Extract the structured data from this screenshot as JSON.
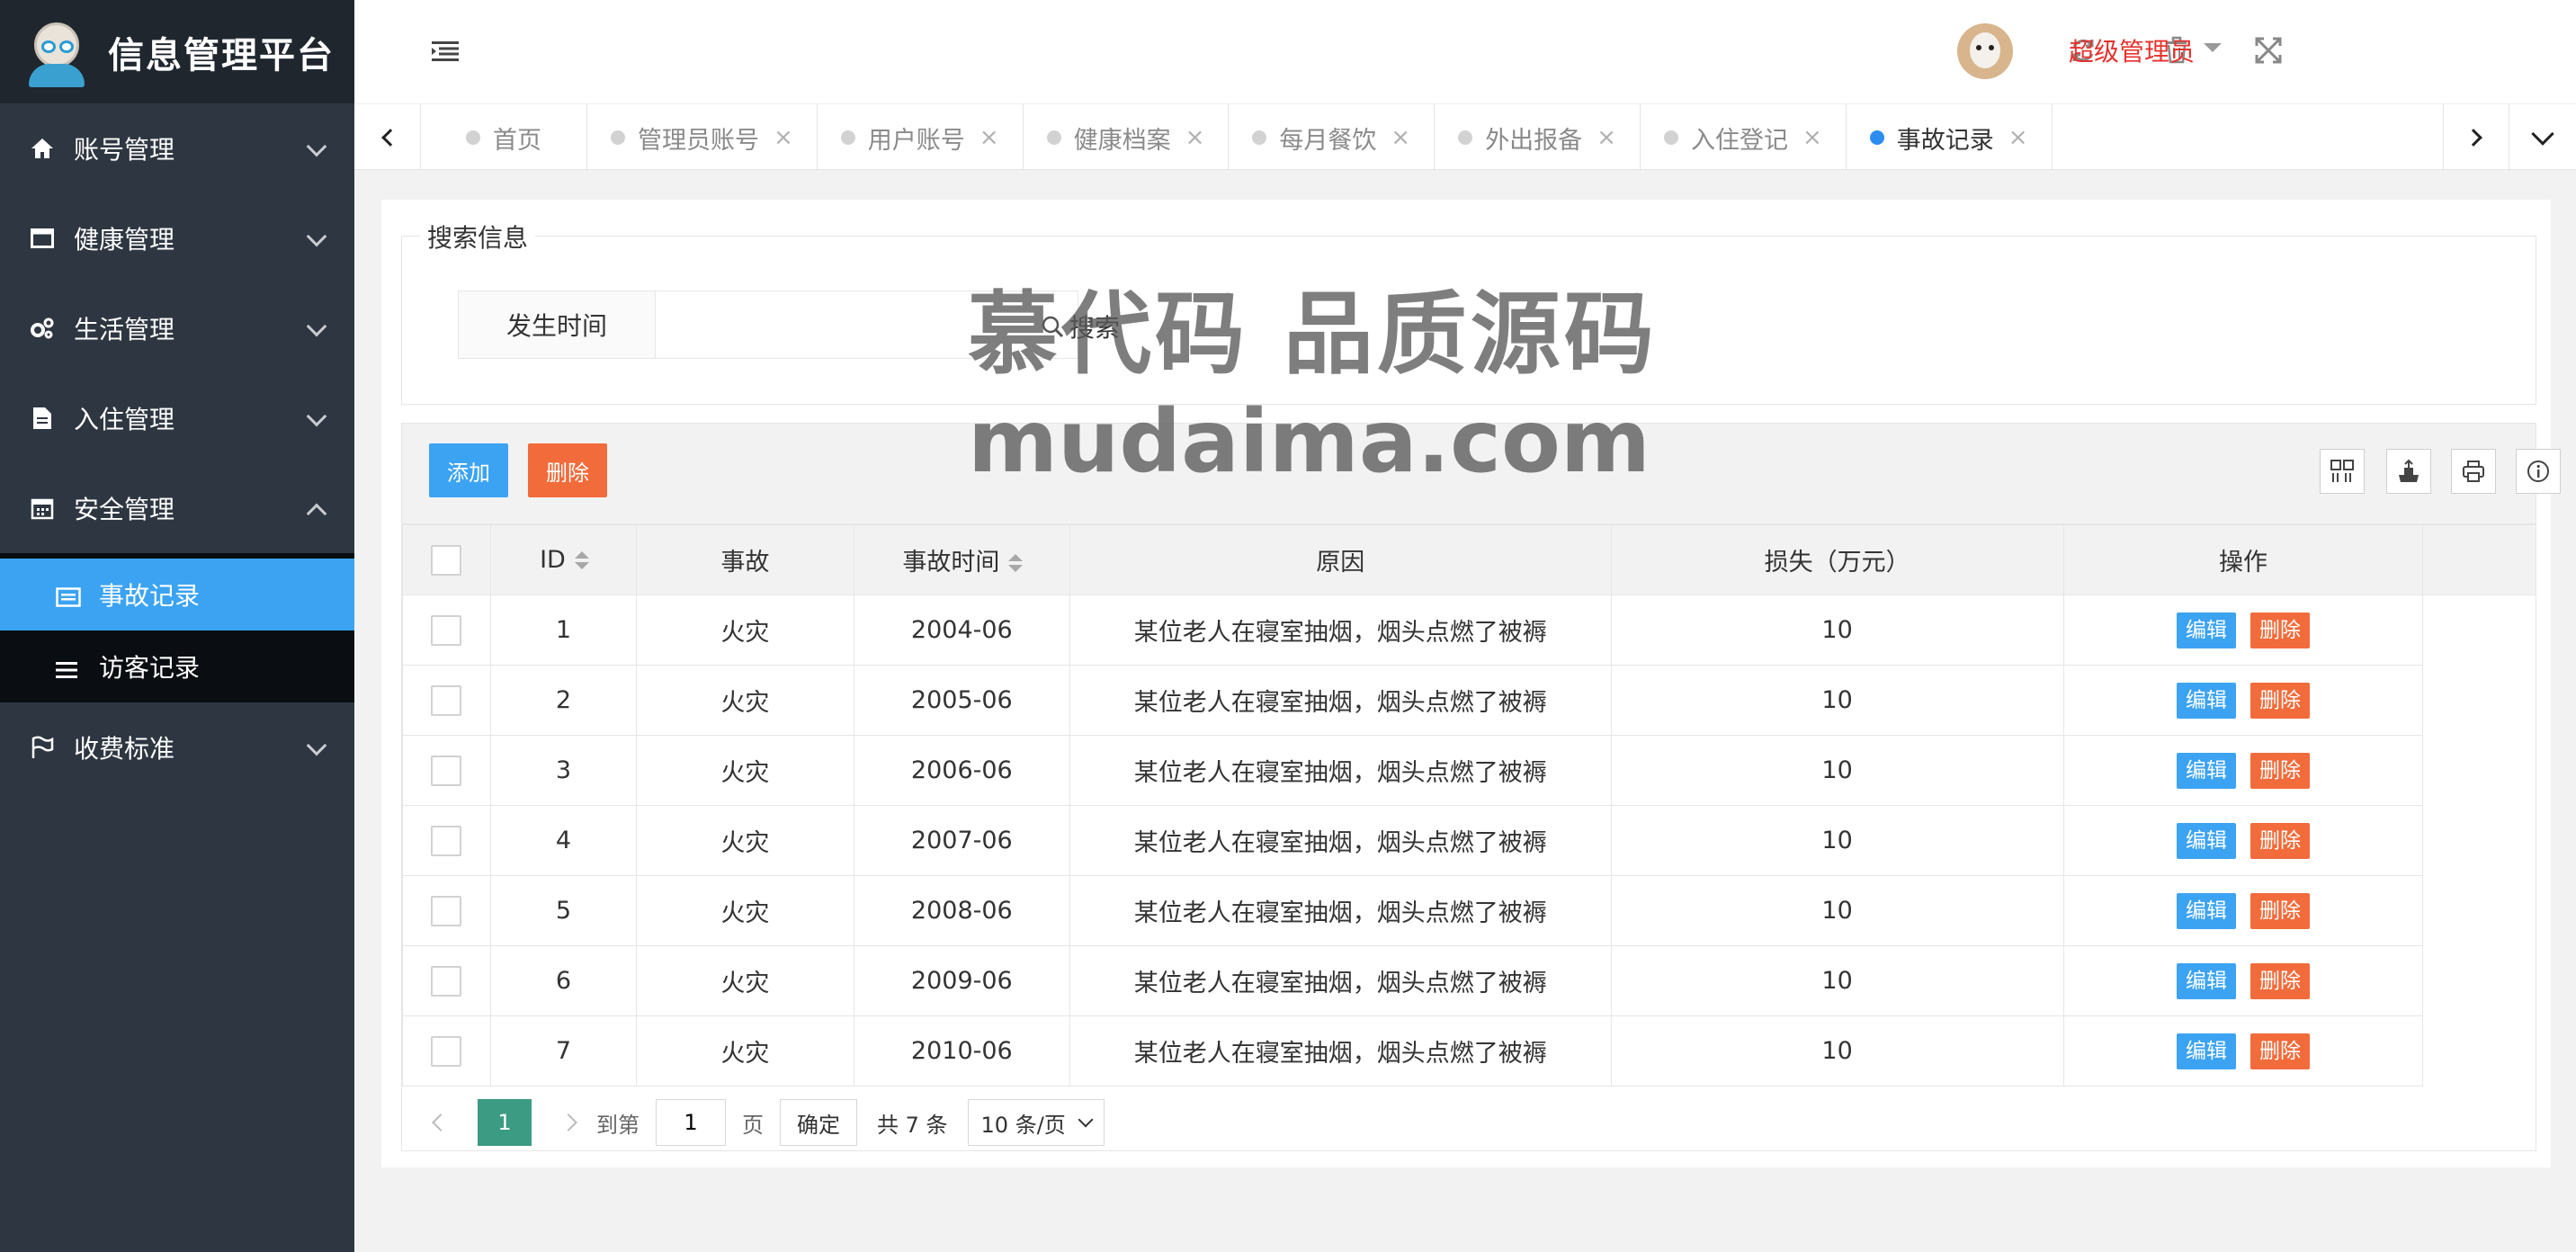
{
  "app": {
    "title": "信息管理平台"
  },
  "sidebar": {
    "items": [
      {
        "label": "账号管理",
        "icon": "home-icon"
      },
      {
        "label": "健康管理",
        "icon": "window-icon"
      },
      {
        "label": "生活管理",
        "icon": "gears-icon"
      },
      {
        "label": "入住管理",
        "icon": "document-icon"
      },
      {
        "label": "安全管理",
        "icon": "calendar-icon"
      }
    ],
    "submenu": [
      {
        "label": "事故记录",
        "icon": "list-card-icon",
        "active": true
      },
      {
        "label": "访客记录",
        "icon": "menu-lines-icon"
      }
    ],
    "after": {
      "label": "收费标准",
      "icon": "flag-icon"
    }
  },
  "header": {
    "user": "超级管理员"
  },
  "tabs": [
    {
      "label": "首页",
      "closable": false
    },
    {
      "label": "管理员账号",
      "closable": true
    },
    {
      "label": "用户账号",
      "closable": true
    },
    {
      "label": "健康档案",
      "closable": true
    },
    {
      "label": "每月餐饮",
      "closable": true
    },
    {
      "label": "外出报备",
      "closable": true
    },
    {
      "label": "入住登记",
      "closable": true
    },
    {
      "label": "事故记录",
      "closable": true,
      "active": true
    }
  ],
  "search": {
    "legend": "搜索信息",
    "label": "发生时间",
    "value": "",
    "button": "搜索"
  },
  "toolbar": {
    "add": "添加",
    "delete": "删除"
  },
  "table": {
    "headers": {
      "id": "ID",
      "accident": "事故",
      "time": "事故时间",
      "reason": "原因",
      "loss": "损失（万元）",
      "ops": "操作"
    },
    "rows": [
      {
        "id": "1",
        "accident": "火灾",
        "time": "2004-06",
        "reason": "某位老人在寝室抽烟，烟头点燃了被褥",
        "loss": "10"
      },
      {
        "id": "2",
        "accident": "火灾",
        "time": "2005-06",
        "reason": "某位老人在寝室抽烟，烟头点燃了被褥",
        "loss": "10"
      },
      {
        "id": "3",
        "accident": "火灾",
        "time": "2006-06",
        "reason": "某位老人在寝室抽烟，烟头点燃了被褥",
        "loss": "10"
      },
      {
        "id": "4",
        "accident": "火灾",
        "time": "2007-06",
        "reason": "某位老人在寝室抽烟，烟头点燃了被褥",
        "loss": "10"
      },
      {
        "id": "5",
        "accident": "火灾",
        "time": "2008-06",
        "reason": "某位老人在寝室抽烟，烟头点燃了被褥",
        "loss": "10"
      },
      {
        "id": "6",
        "accident": "火灾",
        "time": "2009-06",
        "reason": "某位老人在寝室抽烟，烟头点燃了被褥",
        "loss": "10"
      },
      {
        "id": "7",
        "accident": "火灾",
        "time": "2010-06",
        "reason": "某位老人在寝室抽烟，烟头点燃了被褥",
        "loss": "10"
      }
    ],
    "edit_label": "编辑",
    "delete_label": "删除"
  },
  "pager": {
    "current": "1",
    "goto_prefix": "到第",
    "goto_value": "1",
    "goto_suffix": "页",
    "confirm": "确定",
    "total": "共 7 条",
    "page_size": "10 条/页"
  },
  "watermark": {
    "line1": "慕代码 品质源码",
    "line2": "mudaima.com"
  },
  "colors": {
    "sidebar": "#2e3641",
    "active": "#3ca3f3",
    "danger": "#f26b3a",
    "pager": "#3b9b83",
    "user": "#e5322d"
  }
}
